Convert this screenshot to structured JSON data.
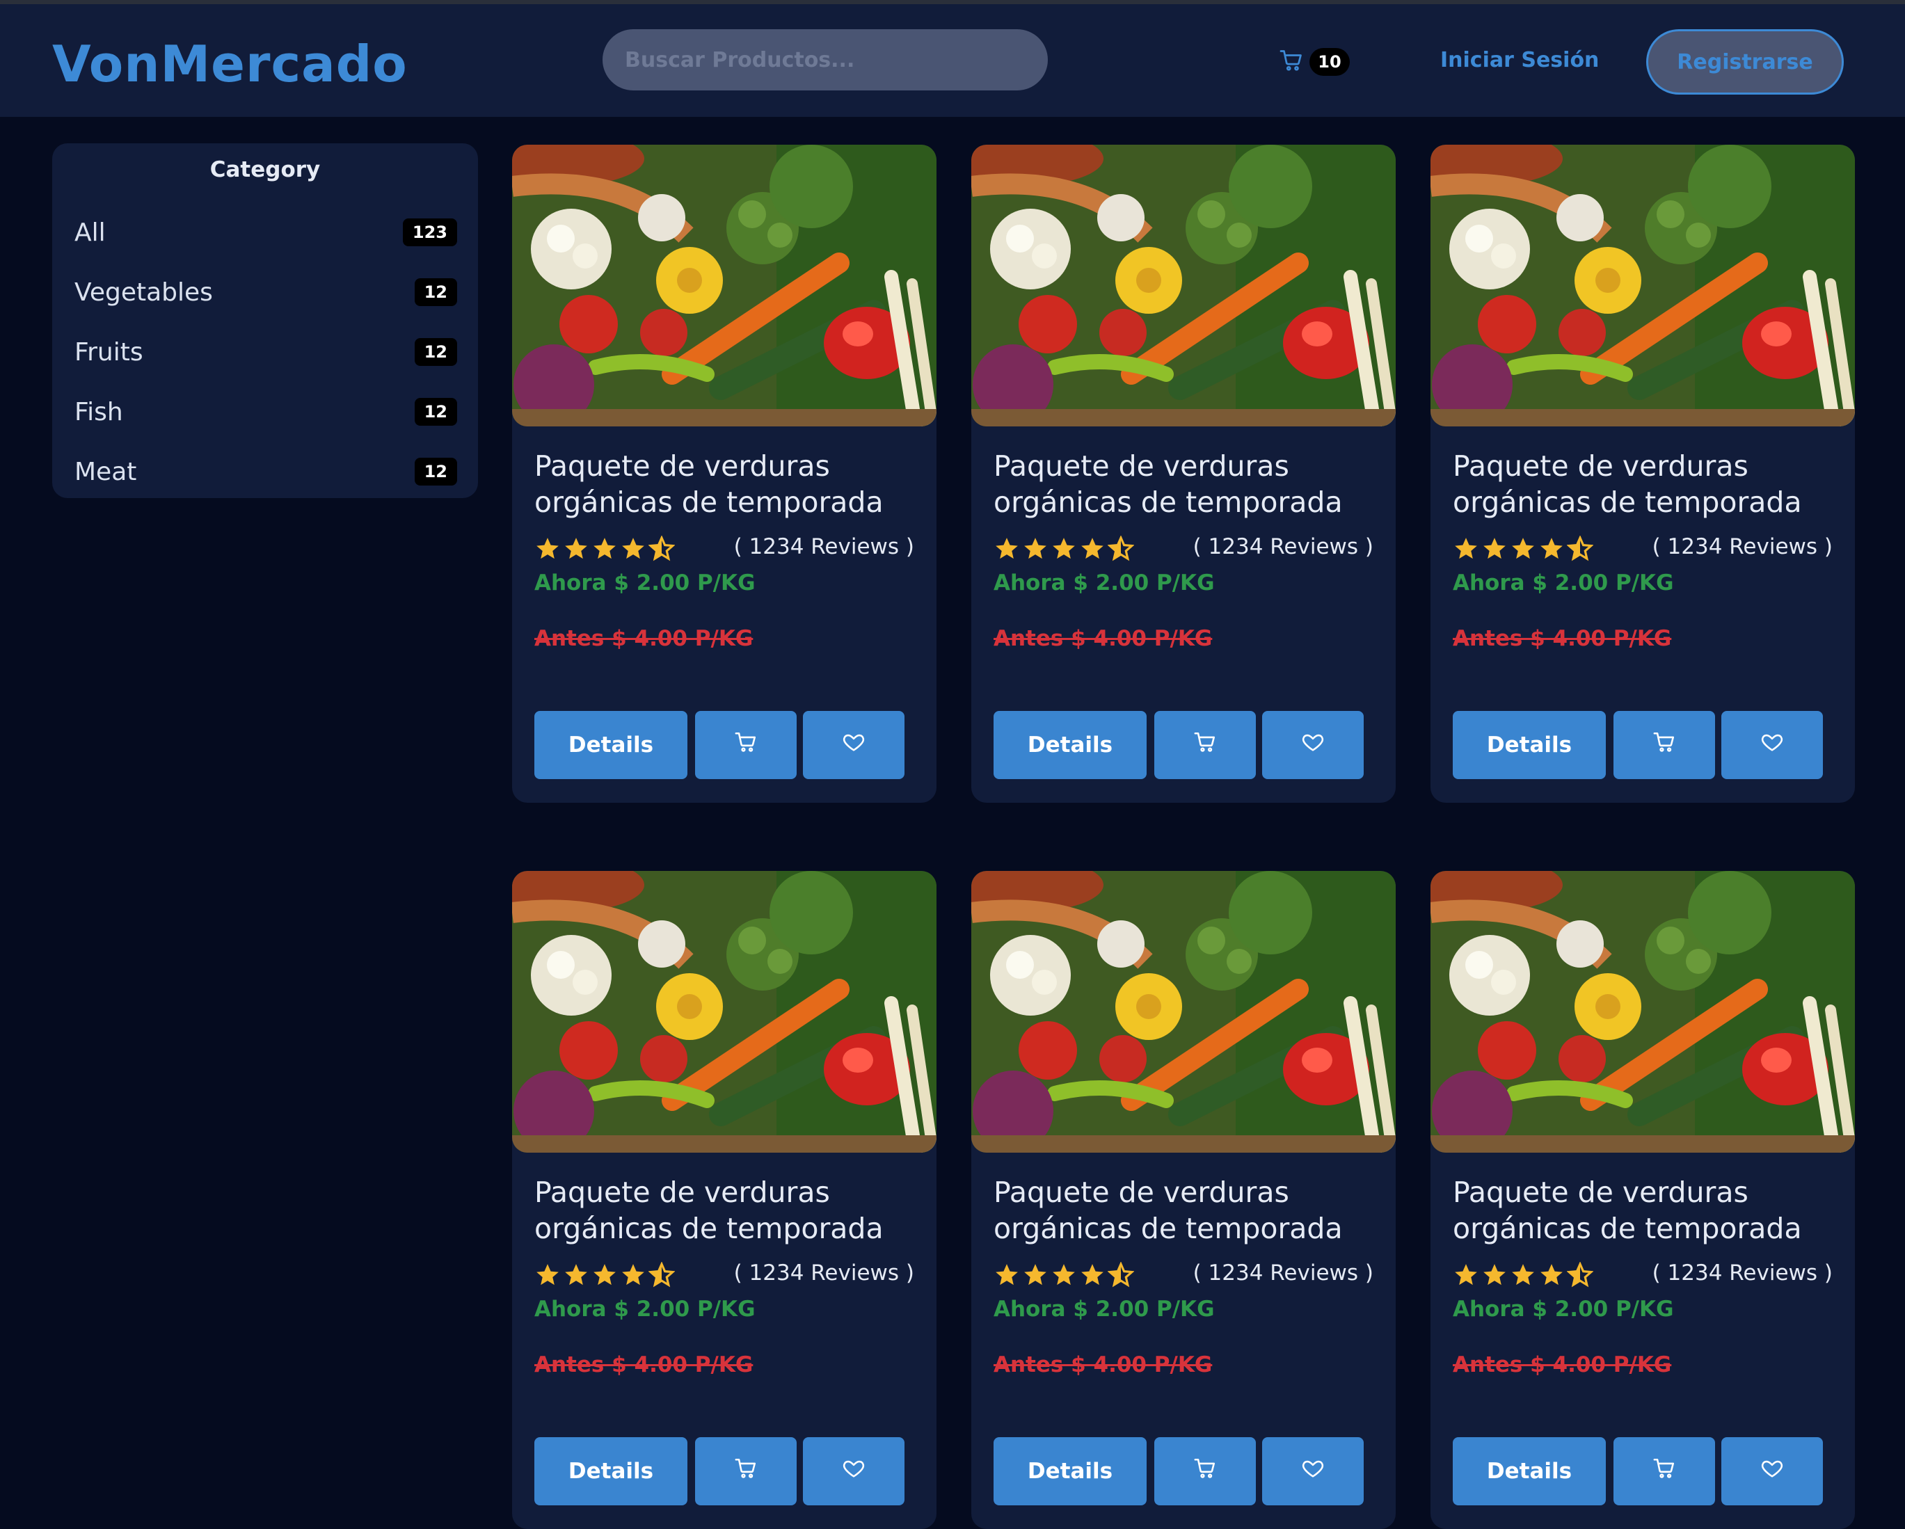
{
  "header": {
    "logo": "VonMercado",
    "search_placeholder": "Buscar Productos...",
    "cart_count": "10",
    "login_label": "Iniciar Sesión",
    "register_label": "Registrarse"
  },
  "sidebar": {
    "title": "Category",
    "items": [
      {
        "label": "All",
        "count": "123"
      },
      {
        "label": "Vegetables",
        "count": "12"
      },
      {
        "label": "Fruits",
        "count": "12"
      },
      {
        "label": "Fish",
        "count": "12"
      },
      {
        "label": "Meat",
        "count": "12"
      }
    ]
  },
  "products": [
    {
      "title": "Paquete de verduras orgánicas de temporada",
      "rating": 4.5,
      "reviews": "( 1234 Reviews )",
      "price_now": "Ahora $ 2.00 P/KG",
      "price_before": "Antes $ 4.00 P/KG",
      "details_label": "Details"
    },
    {
      "title": "Paquete de verduras orgánicas de temporada",
      "rating": 4.5,
      "reviews": "( 1234 Reviews )",
      "price_now": "Ahora $ 2.00 P/KG",
      "price_before": "Antes $ 4.00 P/KG",
      "details_label": "Details"
    },
    {
      "title": "Paquete de verduras orgánicas de temporada",
      "rating": 4.5,
      "reviews": "( 1234 Reviews )",
      "price_now": "Ahora $ 2.00 P/KG",
      "price_before": "Antes $ 4.00 P/KG",
      "details_label": "Details"
    },
    {
      "title": "Paquete de verduras orgánicas de temporada",
      "rating": 4.5,
      "reviews": "( 1234 Reviews )",
      "price_now": "Ahora $ 2.00 P/KG",
      "price_before": "Antes $ 4.00 P/KG",
      "details_label": "Details"
    },
    {
      "title": "Paquete de verduras orgánicas de temporada",
      "rating": 4.5,
      "reviews": "( 1234 Reviews )",
      "price_now": "Ahora $ 2.00 P/KG",
      "price_before": "Antes $ 4.00 P/KG",
      "details_label": "Details"
    },
    {
      "title": "Paquete de verduras orgánicas de temporada",
      "rating": 4.5,
      "reviews": "( 1234 Reviews )",
      "price_now": "Ahora $ 2.00 P/KG",
      "price_before": "Antes $ 4.00 P/KG",
      "details_label": "Details"
    }
  ],
  "icons": {
    "cart": "cart-icon",
    "heart": "heart-icon",
    "star": "star-icon",
    "star_half": "star-half-icon"
  },
  "colors": {
    "background": "#050b1f",
    "panel": "#111c3a",
    "accent": "#3a85d0",
    "price_now": "#2f9a4c",
    "price_before": "#d8333b",
    "star": "#f5b82e"
  }
}
